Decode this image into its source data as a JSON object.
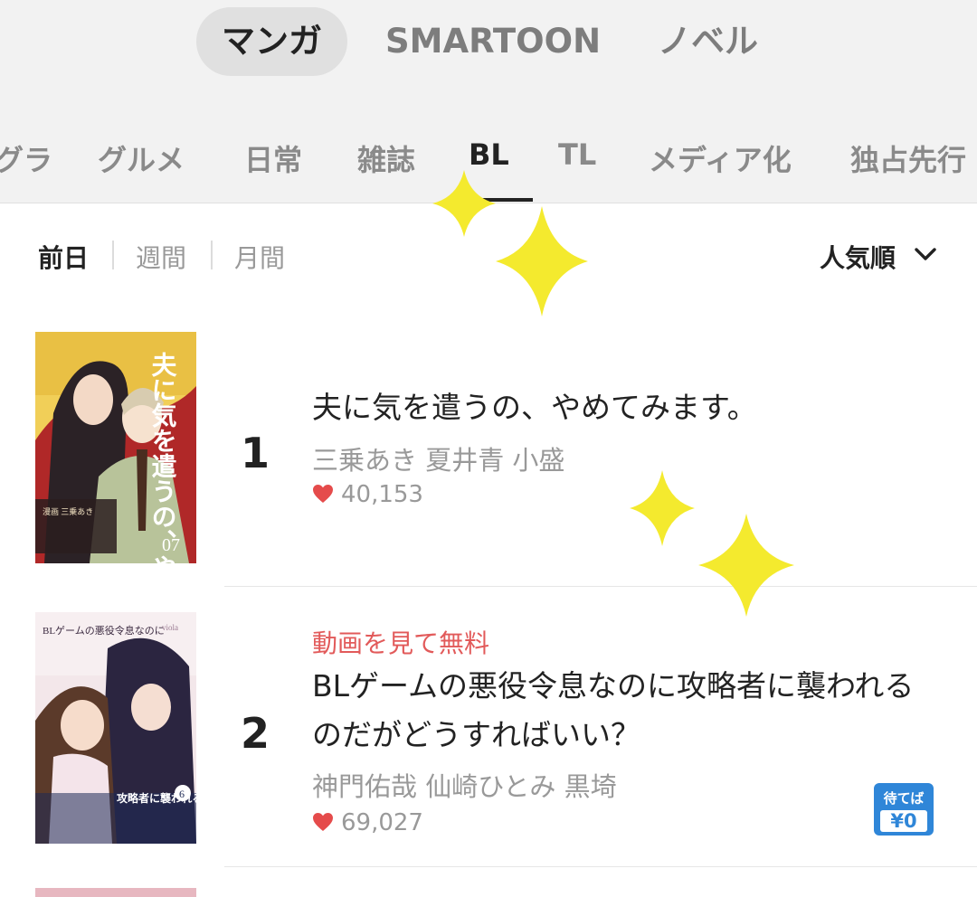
{
  "main_tabs": [
    {
      "label": "マンガ",
      "active": true
    },
    {
      "label": "SMARTOON",
      "active": false
    },
    {
      "label": "ノベル",
      "active": false
    }
  ],
  "genre_tabs": [
    {
      "label": "グラ"
    },
    {
      "label": "グルメ"
    },
    {
      "label": "日常"
    },
    {
      "label": "雑誌"
    },
    {
      "label": "BL",
      "active": true
    },
    {
      "label": "TL"
    },
    {
      "label": "メディア化"
    },
    {
      "label": "独占先行"
    }
  ],
  "period_tabs": [
    {
      "label": "前日",
      "active": true
    },
    {
      "label": "週間"
    },
    {
      "label": "月間"
    }
  ],
  "sort": {
    "label": "人気順",
    "icon": "chevron-down-icon"
  },
  "items": [
    {
      "rank": "1",
      "title": "夫に気を遣うの、やめてみます。",
      "authors": "三乗あき 夏井青 小盛",
      "likes": "40,153",
      "cover": {
        "title_text": "夫に気を遣うの、やめてみます。",
        "volume": "07",
        "credit_line": "漫画 三乗あき"
      }
    },
    {
      "rank": "2",
      "promo": "動画を見て無料",
      "title_line1": "BLゲームの悪役令息なのに攻略者に襲われる",
      "title_line2": "のだがどうすればいい？",
      "authors": "神門佑哉 仙崎ひとみ 黒埼",
      "likes": "69,027",
      "badge": {
        "line1": "待てば",
        "line2": "¥0"
      },
      "cover": {
        "title_text": "BLゲームの悪役令息なのに",
        "volume": "6",
        "subtitle_text": "攻略者に襲われるのだがどうすればいい？",
        "brand": "viola"
      }
    }
  ],
  "colors": {
    "accent": "#2f86d8",
    "heart": "#e54b4b",
    "promo": "#e25a5a",
    "sparkle": "#f4ea2e"
  }
}
